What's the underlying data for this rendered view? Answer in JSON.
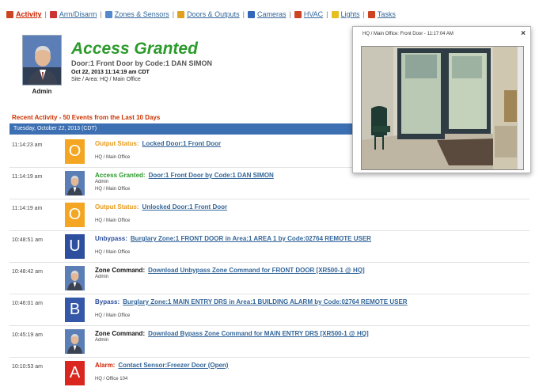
{
  "nav": {
    "items": [
      {
        "label": "Activity",
        "icon": "activity-icon",
        "color": "#cc4422"
      },
      {
        "label": "Arm/Disarm",
        "icon": "arm-disarm-icon",
        "color": "#cc3333"
      },
      {
        "label": "Zones & Sensors",
        "icon": "zones-icon",
        "color": "#5588cc"
      },
      {
        "label": "Doors & Outputs",
        "icon": "doors-icon",
        "color": "#e0a020"
      },
      {
        "label": "Cameras",
        "icon": "camera-icon",
        "color": "#3366bb"
      },
      {
        "label": "HVAC",
        "icon": "hvac-icon",
        "color": "#cc4422"
      },
      {
        "label": "Lights",
        "icon": "lights-icon",
        "color": "#e6c020"
      },
      {
        "label": "Tasks",
        "icon": "tasks-icon",
        "color": "#cc4422"
      }
    ]
  },
  "header": {
    "user_label": "Admin",
    "title": "Access Granted",
    "subtitle": "Door:1 Front Door by Code:1 DAN SIMON",
    "datetime": "Oct 22, 2013 11:14:19 am CDT",
    "site": "Site / Area: HQ / Main Office"
  },
  "recent_heading": "Recent Activity - 50 Events from the Last 10 Days",
  "date_bar": "Tuesday, October 22, 2013 (CDT)",
  "events": [
    {
      "time": "11:14:23 am",
      "icon": "O",
      "icon_kind": "o",
      "type": "Output Status:",
      "type_color": "orange",
      "link": "Locked Door:1 Front Door",
      "user": "",
      "site": "HQ / Main Office"
    },
    {
      "time": "11:14:19 am",
      "icon": "",
      "icon_kind": "photo",
      "type": "Access Granted:",
      "type_color": "green",
      "link": "Door:1 Front Door by Code:1 DAN SIMON",
      "user": "Admin",
      "site": "HQ / Main Office"
    },
    {
      "time": "11:14:19 am",
      "icon": "O",
      "icon_kind": "o",
      "type": "Output Status:",
      "type_color": "orange",
      "link": "Unlocked Door:1 Front Door",
      "user": "",
      "site": "HQ / Main Office"
    },
    {
      "time": "10:48:51 am",
      "icon": "U",
      "icon_kind": "u",
      "type": "Unbypass:",
      "type_color": "blue",
      "link": "Burglary Zone:1 FRONT DOOR in Area:1 AREA 1 by Code:02764 REMOTE USER",
      "user": "",
      "site": "HQ / Main Office"
    },
    {
      "time": "10:48:42 am",
      "icon": "",
      "icon_kind": "photo",
      "type": "Zone Command:",
      "type_color": "black",
      "link": "Download Unbypass Zone Command for FRONT DOOR [XR500-1 @ HQ]",
      "user": "Admin",
      "site": ""
    },
    {
      "time": "10:46:01 am",
      "icon": "B",
      "icon_kind": "b",
      "type": "Bypass:",
      "type_color": "blue",
      "link": "Burglary Zone:1 MAIN ENTRY DRS in Area:1 BUILDING ALARM by Code:02764 REMOTE USER",
      "user": "",
      "site": "HQ / Main Office"
    },
    {
      "time": "10:45:19 am",
      "icon": "",
      "icon_kind": "photo",
      "type": "Zone Command:",
      "type_color": "black",
      "link": "Download Bypass Zone Command for MAIN ENTRY DRS [XR500-1 @ HQ]",
      "user": "Admin",
      "site": ""
    },
    {
      "time": "10:10:53 am",
      "icon": "A",
      "icon_kind": "a",
      "type": "Alarm:",
      "type_color": "red",
      "link": "Contact Sensor:Freezer Door (Open)",
      "user": "",
      "site": "HQ / Office 104"
    }
  ],
  "camera": {
    "title": "HQ / Main Office: Front Door - 11:17:04 AM",
    "close": "×"
  },
  "colors": {
    "accent_blue": "#3d70b3",
    "granted_green": "#2c9a2c",
    "output_orange": "#f4a623",
    "alarm_red": "#d9271f"
  }
}
